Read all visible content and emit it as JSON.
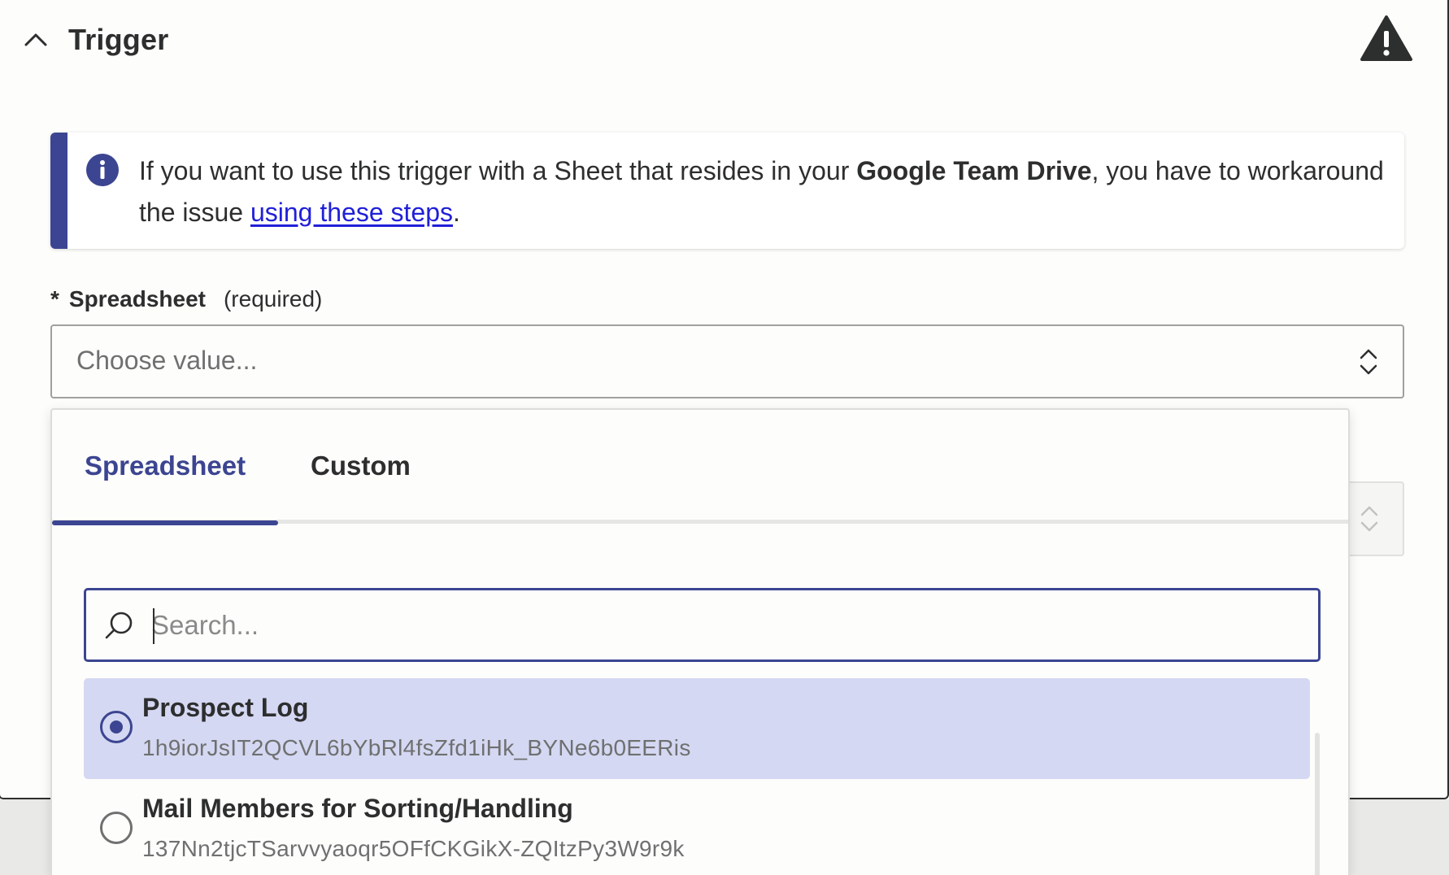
{
  "header": {
    "title": "Trigger"
  },
  "alert": {
    "text_before": "If you want to use this trigger with a Sheet that resides in your ",
    "bold_text": "Google Team Drive",
    "text_middle": ", you have to workaround the issue ",
    "link_text": "using these steps",
    "text_after": "."
  },
  "field": {
    "required_mark": "*",
    "label": "Spreadsheet",
    "hint": "(required)",
    "placeholder": "Choose value..."
  },
  "dropdown": {
    "tabs": [
      {
        "label": "Spreadsheet",
        "active": true
      },
      {
        "label": "Custom",
        "active": false
      }
    ],
    "search_placeholder": "Search...",
    "items": [
      {
        "title": "Prospect Log",
        "id": "1h9iorJsIT2QCVL6bYbRl4fsZfd1iHk_BYNe6b0EERis",
        "selected": true
      },
      {
        "title": "Mail Members for Sorting/Handling",
        "id": "137Nn2tjcTSarvvyaoqr5OFfCKGikX-ZQItzPy3W9r9k",
        "selected": false
      }
    ]
  },
  "colors": {
    "accent": "#3c4591",
    "selected_bg": "#d4d8f2",
    "link": "#2020d8",
    "text": "#2d2e2e",
    "muted": "#6f7070"
  }
}
